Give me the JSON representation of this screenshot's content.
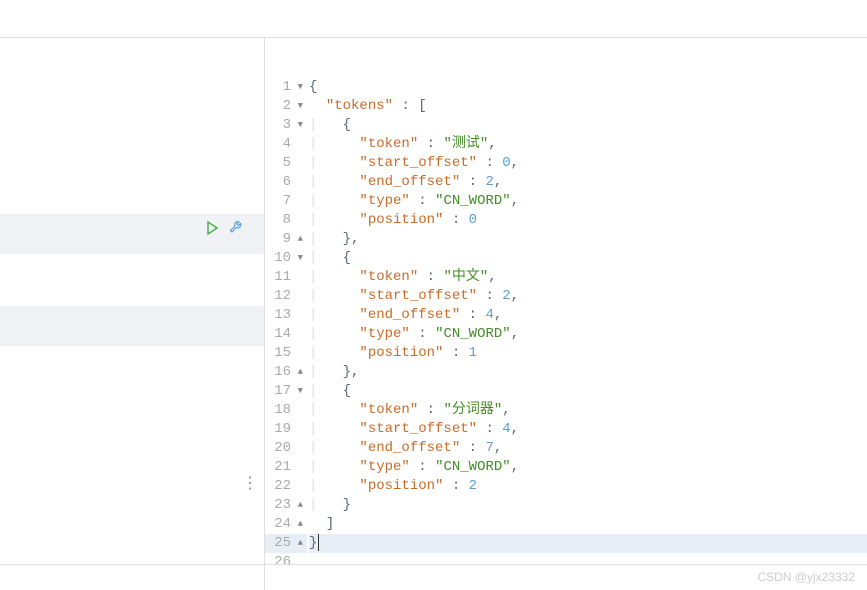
{
  "watermark": "CSDN @yjx23332",
  "lines": [
    {
      "n": 1,
      "fold": "down",
      "tokens": [
        {
          "t": "{",
          "c": "punct"
        }
      ]
    },
    {
      "n": 2,
      "fold": "down",
      "tokens": [
        {
          "t": "  ",
          "c": ""
        },
        {
          "t": "\"tokens\"",
          "c": "key"
        },
        {
          "t": " : [",
          "c": "punct"
        }
      ]
    },
    {
      "n": 3,
      "fold": "down",
      "tokens": [
        {
          "t": "| ",
          "c": "indent-guide"
        },
        {
          "t": "  ",
          "c": ""
        },
        {
          "t": "{",
          "c": "punct"
        }
      ]
    },
    {
      "n": 4,
      "fold": "",
      "tokens": [
        {
          "t": "|   ",
          "c": "indent-guide"
        },
        {
          "t": "  ",
          "c": ""
        },
        {
          "t": "\"token\"",
          "c": "key"
        },
        {
          "t": " : ",
          "c": "punct"
        },
        {
          "t": "\"测试\"",
          "c": "str"
        },
        {
          "t": ",",
          "c": "punct"
        }
      ]
    },
    {
      "n": 5,
      "fold": "",
      "tokens": [
        {
          "t": "|   ",
          "c": "indent-guide"
        },
        {
          "t": "  ",
          "c": ""
        },
        {
          "t": "\"start_offset\"",
          "c": "key"
        },
        {
          "t": " : ",
          "c": "punct"
        },
        {
          "t": "0",
          "c": "num"
        },
        {
          "t": ",",
          "c": "punct"
        }
      ]
    },
    {
      "n": 6,
      "fold": "",
      "tokens": [
        {
          "t": "|   ",
          "c": "indent-guide"
        },
        {
          "t": "  ",
          "c": ""
        },
        {
          "t": "\"end_offset\"",
          "c": "key"
        },
        {
          "t": " : ",
          "c": "punct"
        },
        {
          "t": "2",
          "c": "num"
        },
        {
          "t": ",",
          "c": "punct"
        }
      ]
    },
    {
      "n": 7,
      "fold": "",
      "tokens": [
        {
          "t": "|   ",
          "c": "indent-guide"
        },
        {
          "t": "  ",
          "c": ""
        },
        {
          "t": "\"type\"",
          "c": "key"
        },
        {
          "t": " : ",
          "c": "punct"
        },
        {
          "t": "\"CN_WORD\"",
          "c": "str"
        },
        {
          "t": ",",
          "c": "punct"
        }
      ]
    },
    {
      "n": 8,
      "fold": "",
      "tokens": [
        {
          "t": "|   ",
          "c": "indent-guide"
        },
        {
          "t": "  ",
          "c": ""
        },
        {
          "t": "\"position\"",
          "c": "key"
        },
        {
          "t": " : ",
          "c": "punct"
        },
        {
          "t": "0",
          "c": "num"
        }
      ]
    },
    {
      "n": 9,
      "fold": "up",
      "tokens": [
        {
          "t": "| ",
          "c": "indent-guide"
        },
        {
          "t": "  ",
          "c": ""
        },
        {
          "t": "},",
          "c": "punct"
        }
      ]
    },
    {
      "n": 10,
      "fold": "down",
      "tokens": [
        {
          "t": "| ",
          "c": "indent-guide"
        },
        {
          "t": "  ",
          "c": ""
        },
        {
          "t": "{",
          "c": "punct"
        }
      ]
    },
    {
      "n": 11,
      "fold": "",
      "tokens": [
        {
          "t": "|   ",
          "c": "indent-guide"
        },
        {
          "t": "  ",
          "c": ""
        },
        {
          "t": "\"token\"",
          "c": "key"
        },
        {
          "t": " : ",
          "c": "punct"
        },
        {
          "t": "\"中文\"",
          "c": "str"
        },
        {
          "t": ",",
          "c": "punct"
        }
      ]
    },
    {
      "n": 12,
      "fold": "",
      "tokens": [
        {
          "t": "|   ",
          "c": "indent-guide"
        },
        {
          "t": "  ",
          "c": ""
        },
        {
          "t": "\"start_offset\"",
          "c": "key"
        },
        {
          "t": " : ",
          "c": "punct"
        },
        {
          "t": "2",
          "c": "num"
        },
        {
          "t": ",",
          "c": "punct"
        }
      ]
    },
    {
      "n": 13,
      "fold": "",
      "tokens": [
        {
          "t": "|   ",
          "c": "indent-guide"
        },
        {
          "t": "  ",
          "c": ""
        },
        {
          "t": "\"end_offset\"",
          "c": "key"
        },
        {
          "t": " : ",
          "c": "punct"
        },
        {
          "t": "4",
          "c": "num"
        },
        {
          "t": ",",
          "c": "punct"
        }
      ]
    },
    {
      "n": 14,
      "fold": "",
      "tokens": [
        {
          "t": "|   ",
          "c": "indent-guide"
        },
        {
          "t": "  ",
          "c": ""
        },
        {
          "t": "\"type\"",
          "c": "key"
        },
        {
          "t": " : ",
          "c": "punct"
        },
        {
          "t": "\"CN_WORD\"",
          "c": "str"
        },
        {
          "t": ",",
          "c": "punct"
        }
      ]
    },
    {
      "n": 15,
      "fold": "",
      "tokens": [
        {
          "t": "|   ",
          "c": "indent-guide"
        },
        {
          "t": "  ",
          "c": ""
        },
        {
          "t": "\"position\"",
          "c": "key"
        },
        {
          "t": " : ",
          "c": "punct"
        },
        {
          "t": "1",
          "c": "num"
        }
      ]
    },
    {
      "n": 16,
      "fold": "up",
      "tokens": [
        {
          "t": "| ",
          "c": "indent-guide"
        },
        {
          "t": "  ",
          "c": ""
        },
        {
          "t": "},",
          "c": "punct"
        }
      ]
    },
    {
      "n": 17,
      "fold": "down",
      "tokens": [
        {
          "t": "| ",
          "c": "indent-guide"
        },
        {
          "t": "  ",
          "c": ""
        },
        {
          "t": "{",
          "c": "punct"
        }
      ]
    },
    {
      "n": 18,
      "fold": "",
      "tokens": [
        {
          "t": "|   ",
          "c": "indent-guide"
        },
        {
          "t": "  ",
          "c": ""
        },
        {
          "t": "\"token\"",
          "c": "key"
        },
        {
          "t": " : ",
          "c": "punct"
        },
        {
          "t": "\"分词器\"",
          "c": "str"
        },
        {
          "t": ",",
          "c": "punct"
        }
      ]
    },
    {
      "n": 19,
      "fold": "",
      "tokens": [
        {
          "t": "|   ",
          "c": "indent-guide"
        },
        {
          "t": "  ",
          "c": ""
        },
        {
          "t": "\"start_offset\"",
          "c": "key"
        },
        {
          "t": " : ",
          "c": "punct"
        },
        {
          "t": "4",
          "c": "num"
        },
        {
          "t": ",",
          "c": "punct"
        }
      ]
    },
    {
      "n": 20,
      "fold": "",
      "tokens": [
        {
          "t": "|   ",
          "c": "indent-guide"
        },
        {
          "t": "  ",
          "c": ""
        },
        {
          "t": "\"end_offset\"",
          "c": "key"
        },
        {
          "t": " : ",
          "c": "punct"
        },
        {
          "t": "7",
          "c": "num"
        },
        {
          "t": ",",
          "c": "punct"
        }
      ]
    },
    {
      "n": 21,
      "fold": "",
      "tokens": [
        {
          "t": "|   ",
          "c": "indent-guide"
        },
        {
          "t": "  ",
          "c": ""
        },
        {
          "t": "\"type\"",
          "c": "key"
        },
        {
          "t": " : ",
          "c": "punct"
        },
        {
          "t": "\"CN_WORD\"",
          "c": "str"
        },
        {
          "t": ",",
          "c": "punct"
        }
      ]
    },
    {
      "n": 22,
      "fold": "",
      "tokens": [
        {
          "t": "|   ",
          "c": "indent-guide"
        },
        {
          "t": "  ",
          "c": ""
        },
        {
          "t": "\"position\"",
          "c": "key"
        },
        {
          "t": " : ",
          "c": "punct"
        },
        {
          "t": "2",
          "c": "num"
        }
      ]
    },
    {
      "n": 23,
      "fold": "up",
      "tokens": [
        {
          "t": "| ",
          "c": "indent-guide"
        },
        {
          "t": "  ",
          "c": ""
        },
        {
          "t": "}",
          "c": "punct"
        }
      ]
    },
    {
      "n": 24,
      "fold": "up",
      "tokens": [
        {
          "t": "  ",
          "c": ""
        },
        {
          "t": "]",
          "c": "punct"
        }
      ]
    },
    {
      "n": 25,
      "fold": "up",
      "tokens": [
        {
          "t": "}",
          "c": "punct"
        }
      ],
      "hl": true,
      "cursor": true
    },
    {
      "n": 26,
      "fold": "",
      "tokens": []
    }
  ]
}
